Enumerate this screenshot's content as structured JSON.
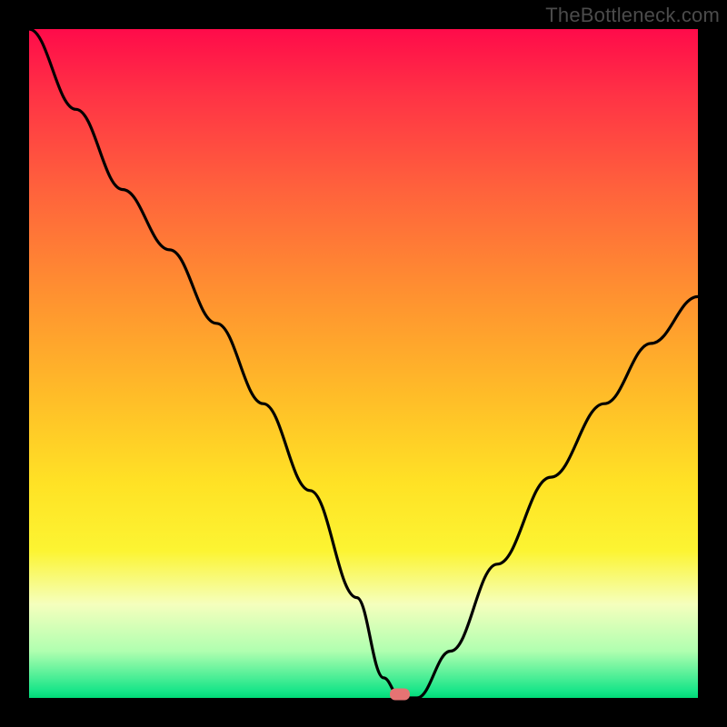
{
  "watermark_text": "TheBottleneck.com",
  "marker": {
    "x_frac": 0.555,
    "y_frac": 0.994
  },
  "chart_data": {
    "type": "line",
    "title": "",
    "xlabel": "",
    "ylabel": "",
    "xlim": [
      0,
      1
    ],
    "ylim": [
      0,
      1
    ],
    "series": [
      {
        "name": "bottleneck-curve",
        "x": [
          0.0,
          0.07,
          0.14,
          0.21,
          0.28,
          0.35,
          0.42,
          0.49,
          0.53,
          0.555,
          0.58,
          0.63,
          0.7,
          0.78,
          0.86,
          0.93,
          1.0
        ],
        "y": [
          1.0,
          0.88,
          0.76,
          0.67,
          0.56,
          0.44,
          0.31,
          0.15,
          0.03,
          0.0,
          0.0,
          0.07,
          0.2,
          0.33,
          0.44,
          0.53,
          0.6
        ]
      }
    ],
    "annotations": [
      {
        "type": "marker",
        "x": 0.555,
        "y": 0.006,
        "color": "#e57373"
      }
    ],
    "background_gradient_stops": [
      {
        "pos": 0.0,
        "color": "#ff0b4a"
      },
      {
        "pos": 0.5,
        "color": "#ffbd28"
      },
      {
        "pos": 0.8,
        "color": "#fcf432"
      },
      {
        "pos": 1.0,
        "color": "#00db77"
      }
    ]
  }
}
